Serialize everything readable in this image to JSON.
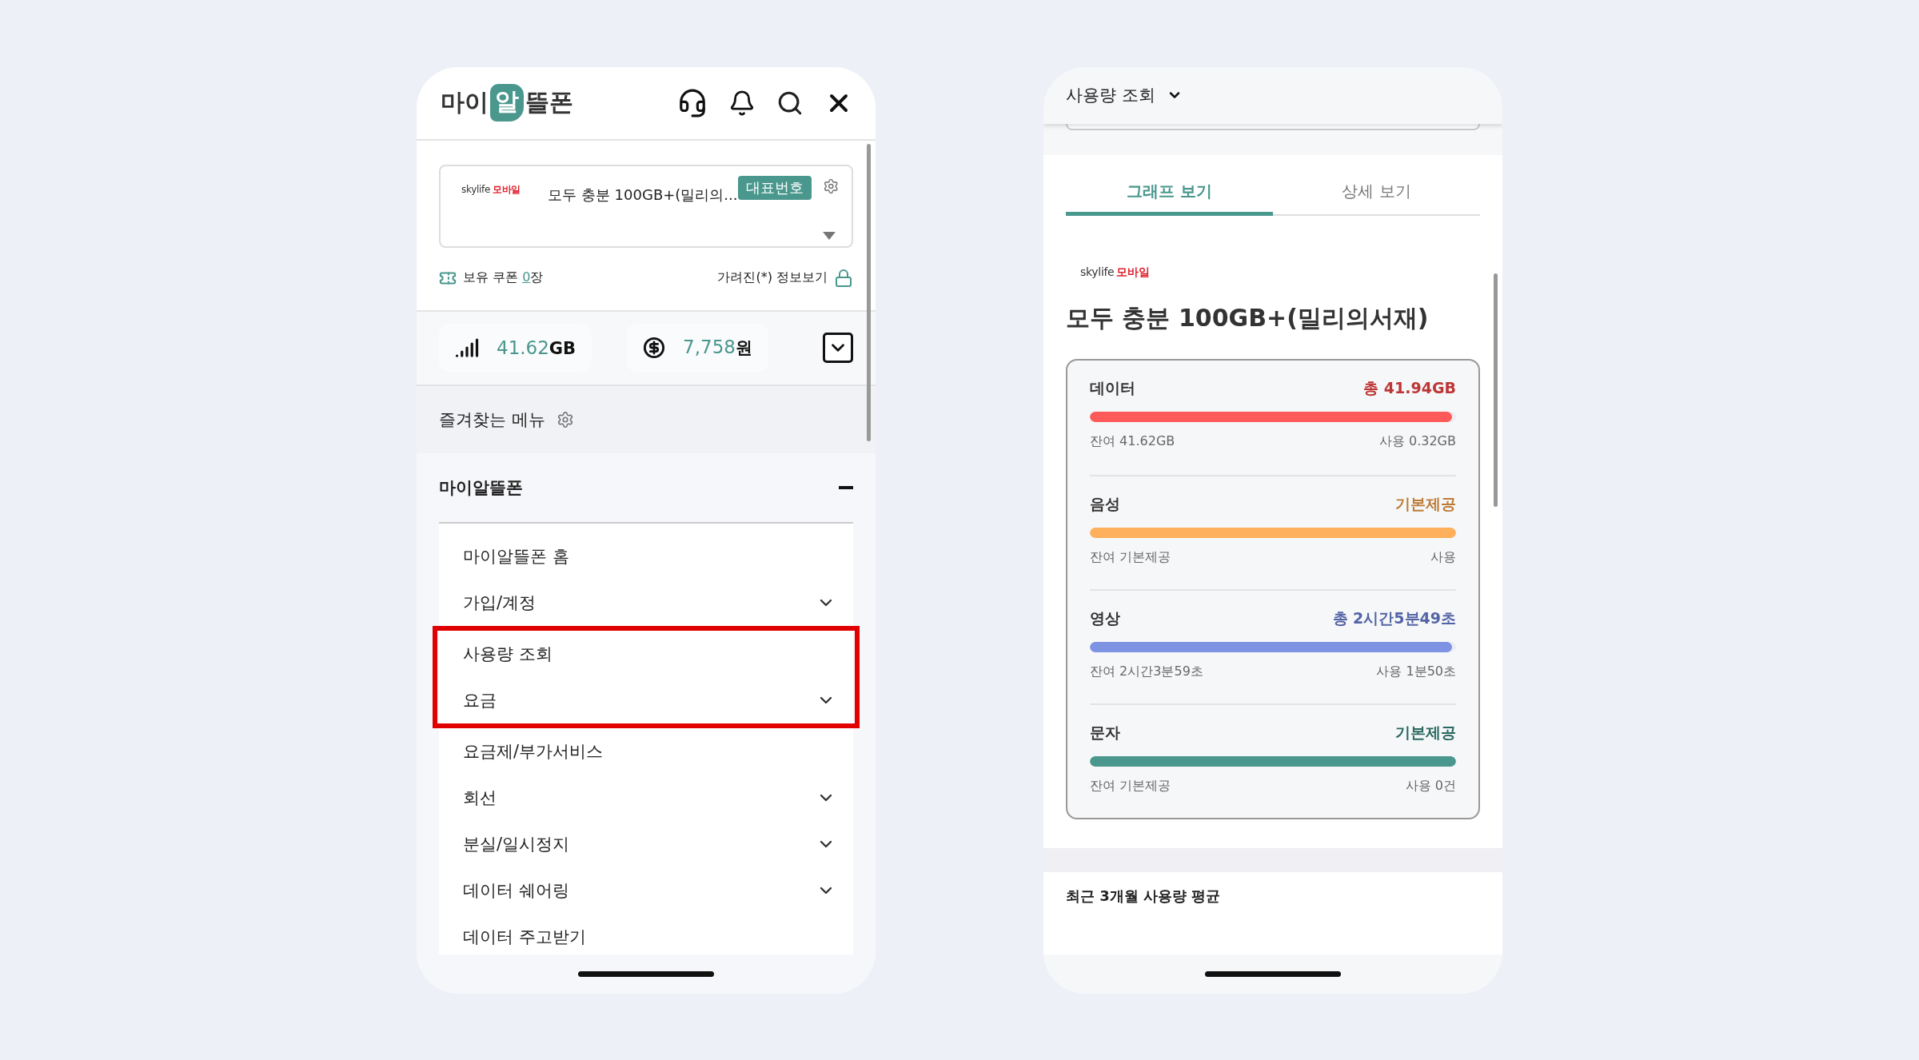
{
  "menu_screen": {
    "logo": {
      "before": "마이",
      "highlight": "알",
      "after": "뜰폰"
    },
    "line_card": {
      "carrier": {
        "name": "skylife",
        "suffix": "모바일"
      },
      "plan": "모두 충분 100GB+(밀리의...",
      "badge": "대표번호"
    },
    "coupon": {
      "label": "보유 쿠폰",
      "count": "0",
      "unit": "장"
    },
    "hidden_info": "가려진(*) 정보보기",
    "stats": [
      {
        "kind": "data",
        "value": "41.62",
        "unit": "GB"
      },
      {
        "kind": "fee",
        "value": "7,758",
        "unit": "원"
      }
    ],
    "favorites": "즐겨찾는 메뉴",
    "section": {
      "title": "마이알뜰폰",
      "expanded": true
    },
    "menu_items": [
      {
        "label": "마이알뜰폰 홈",
        "expandable": false,
        "highlighted": false
      },
      {
        "label": "가입/계정",
        "expandable": true,
        "highlighted": false
      },
      {
        "label": "사용량 조회",
        "expandable": false,
        "highlighted": true
      },
      {
        "label": "요금",
        "expandable": true,
        "highlighted": true
      },
      {
        "label": "요금제/부가서비스",
        "expandable": false,
        "highlighted": false
      },
      {
        "label": "회선",
        "expandable": true,
        "highlighted": false
      },
      {
        "label": "분실/일시정지",
        "expandable": true,
        "highlighted": false
      },
      {
        "label": "데이터 쉐어링",
        "expandable": true,
        "highlighted": false
      },
      {
        "label": "데이터 주고받기",
        "expandable": false,
        "highlighted": false
      }
    ]
  },
  "usage_screen": {
    "title": "사용량 조회",
    "tabs": [
      {
        "label": "그래프 보기",
        "selected": true
      },
      {
        "label": "상세 보기",
        "selected": false
      }
    ],
    "carrier": {
      "name": "skylife",
      "suffix": "모바일"
    },
    "plan": "모두 충분 100GB+(밀리의서재)",
    "usage": [
      {
        "label": "데이터",
        "total": "총 41.94GB",
        "remaining": "잔여 41.62GB",
        "used": "사용 0.32GB",
        "level": 0.99,
        "color": "#ff5a5a"
      },
      {
        "label": "음성",
        "total": "기본제공",
        "remaining": "잔여 기본제공",
        "used": "사용",
        "level": 1,
        "color": "#ffb05c"
      },
      {
        "label": "영상",
        "total": "총 2시간5분49초",
        "remaining": "잔여 2시간3분59초",
        "used": "사용 1분50초",
        "level": 0.99,
        "color": "#7f93e3"
      },
      {
        "label": "문자",
        "total": "기본제공",
        "remaining": "잔여 기본제공",
        "used": "사용 0건",
        "level": 1,
        "color": "#4a978e"
      }
    ],
    "recent_average": "최근 3개월 사용량 평균"
  }
}
